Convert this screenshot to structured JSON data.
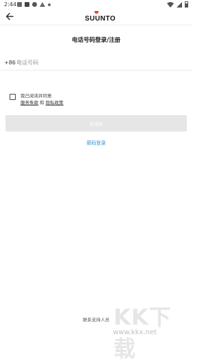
{
  "status_bar": {
    "time": "2:44"
  },
  "header": {
    "logo_text": "SUUNTO",
    "brand_color": "#e8423b"
  },
  "page": {
    "title": "电话号码登录/注册"
  },
  "phone": {
    "country_code": "+86",
    "placeholder": "电话号码",
    "value": ""
  },
  "agreement": {
    "checked": false,
    "line1": "我已阅读并同意",
    "terms_label": "服务条款",
    "and_label": "和",
    "privacy_label": "隐私政策"
  },
  "actions": {
    "verify_button_label": "验证码",
    "password_login_label": "密码登录",
    "link_color": "#2f8fd1"
  },
  "footer": {
    "support_label": "联系支持人员"
  },
  "watermark": {
    "logo_text": "KK下载",
    "url": "www.kkx.net"
  }
}
